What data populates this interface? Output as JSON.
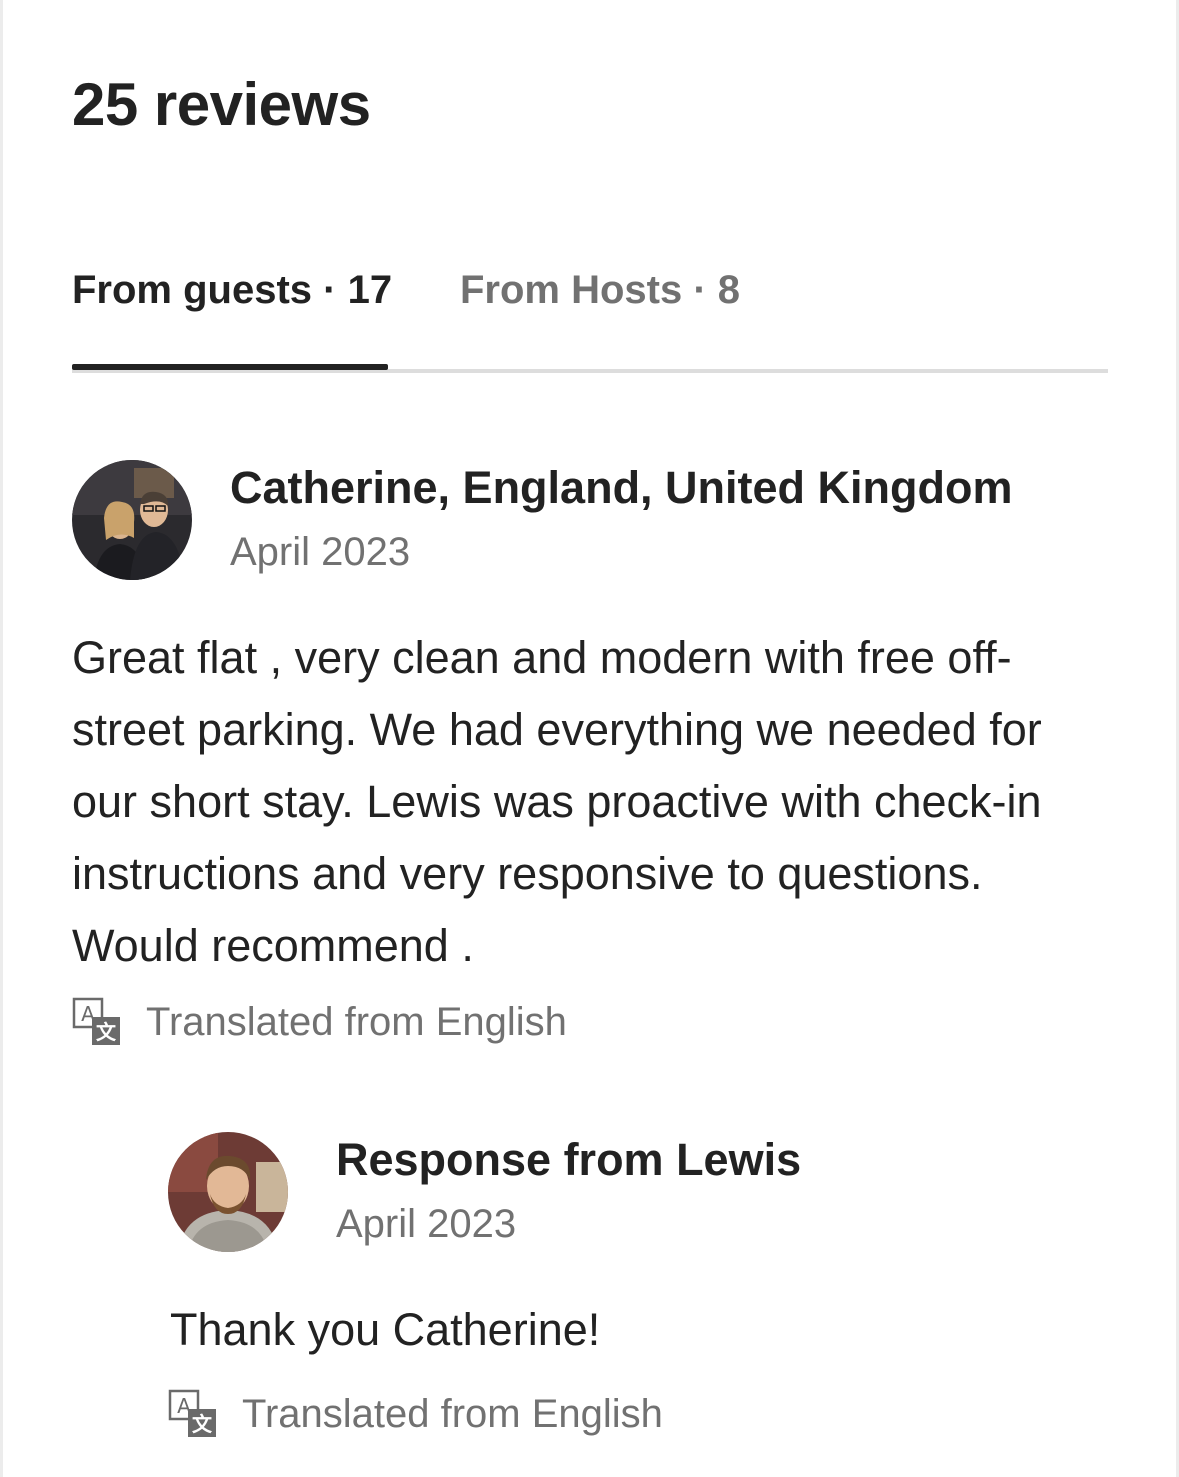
{
  "header": {
    "title": "25 reviews"
  },
  "tabs": [
    {
      "label": "From guests · 17",
      "active": true
    },
    {
      "label": "From Hosts · 8",
      "active": false
    }
  ],
  "review": {
    "reviewer": "Catherine, England, United Kingdom",
    "date": "April 2023",
    "text": "Great flat , very clean and modern with free off-street parking. We had everything we needed for our short stay. Lewis was proactive with check-in instructions and very responsive to questions. Would recommend .",
    "translated_label": "Translated from English",
    "avatar_icon": "user-photo-icon"
  },
  "response": {
    "title": "Response from Lewis",
    "date": "April 2023",
    "text": "Thank you Catherine!",
    "translated_label": "Translated from English",
    "avatar_icon": "host-photo-icon"
  },
  "colors": {
    "primary_text": "#222222",
    "secondary_text": "#717171",
    "divider": "#dddddd"
  }
}
